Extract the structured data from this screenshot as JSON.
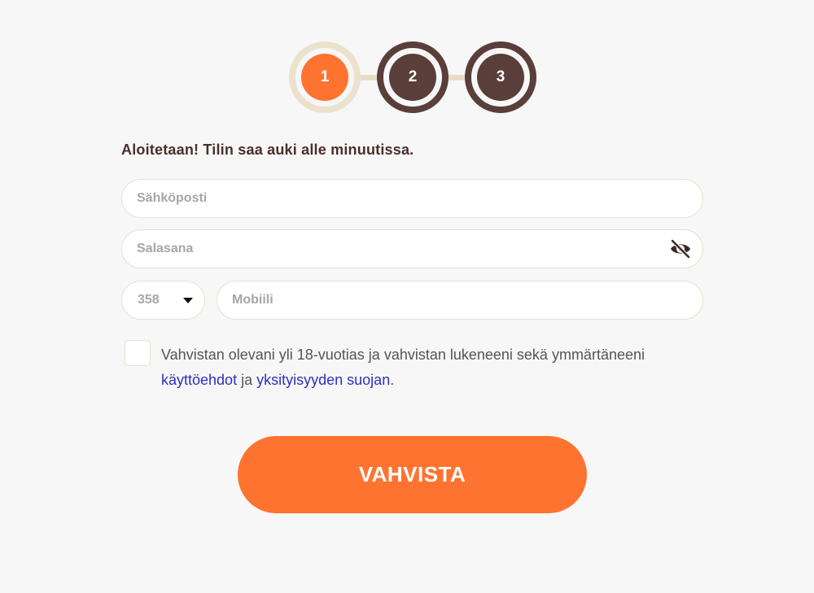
{
  "stepper": {
    "steps": [
      {
        "label": "1",
        "state": "active"
      },
      {
        "label": "2",
        "state": "pending"
      },
      {
        "label": "3",
        "state": "pending"
      }
    ]
  },
  "form": {
    "heading": "Aloitetaan! Tilin saa auki alle minuutissa.",
    "email": {
      "placeholder": "Sähköposti",
      "value": ""
    },
    "password": {
      "placeholder": "Salasana",
      "value": "",
      "toggle_icon": "eye-slash-icon"
    },
    "phone": {
      "country_code": "358",
      "placeholder": "Mobiili",
      "value": ""
    },
    "terms": {
      "checked": false,
      "text_before": "Vahvistan olevani yli 18-vuotias ja vahvistan lukeneeni sekä ymmärtäneeni",
      "link_terms": "käyttöehdot",
      "text_middle": "ja",
      "link_privacy": "yksityisyyden suojan",
      "text_after": "."
    },
    "submit_label": "VAHVISTA"
  },
  "colors": {
    "accent": "#ff7330",
    "brown": "#5a3e3a",
    "link": "#2d2fbf",
    "background": "#f7f7f7"
  }
}
